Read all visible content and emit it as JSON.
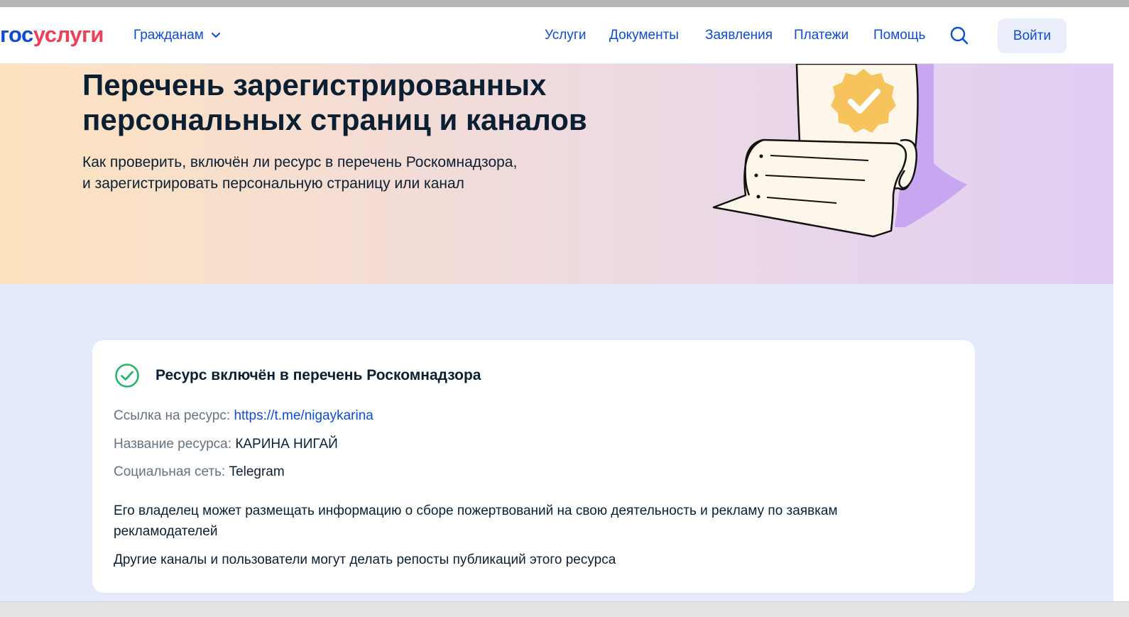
{
  "header": {
    "logo": {
      "part1": "гос",
      "part2": "услуги"
    },
    "citizens_label": "Гражданам",
    "nav": [
      {
        "label": "Услуги"
      },
      {
        "label": "Документы"
      },
      {
        "label": "Заявления"
      },
      {
        "label": "Платежи"
      },
      {
        "label": "Помощь"
      }
    ],
    "login_label": "Войти"
  },
  "hero": {
    "title_line1": "Перечень зарегистрированных",
    "title_line2": "персональных страниц и каналов",
    "subtitle_line1": "Как проверить, включён ли ресурс в перечень Роскомнадзора,",
    "subtitle_line2": "и зарегистрировать персональную страницу или канал"
  },
  "result": {
    "status_title": "Ресурс включён в перечень Роскомнадзора",
    "link_label": "Ссылка на ресурс:",
    "link_value": "https://t.me/nigaykarina",
    "name_label": "Название ресурса:",
    "name_value": "КАРИНА НИГАЙ",
    "network_label": "Социальная сеть:",
    "network_value": "Telegram",
    "note1": "Его владелец может размещать информацию о сборе пожертвований на свою деятельность и рекламу по заявкам рекламодателей",
    "note2": "Другие каналы и пользователи могут делать репосты публикаций этого ресурса"
  },
  "colors": {
    "brand_blue": "#0d4cd3",
    "brand_red": "#ee3f58",
    "success_green": "#2ab46a",
    "page_bg": "#e4e9fb"
  }
}
